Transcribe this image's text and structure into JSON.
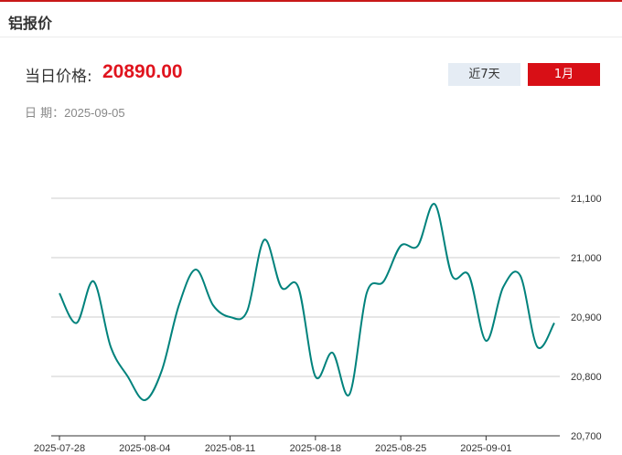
{
  "header": {
    "title": "铝报价"
  },
  "price": {
    "label": "当日价格:",
    "value": "20890.00"
  },
  "date": {
    "label": "日 期：",
    "value": "2025-09-05"
  },
  "buttons": {
    "week": "近7天",
    "month": "1月"
  },
  "colors": {
    "accent": "#d80f16",
    "price": "#e0141e",
    "line": "#00827c",
    "button_inactive": "#e5ecf4"
  },
  "chart_data": {
    "type": "line",
    "x": [
      "2025-07-28",
      "2025-07-29",
      "2025-07-30",
      "2025-07-31",
      "2025-08-01",
      "2025-08-04",
      "2025-08-05",
      "2025-08-06",
      "2025-08-07",
      "2025-08-08",
      "2025-08-11",
      "2025-08-12",
      "2025-08-13",
      "2025-08-14",
      "2025-08-15",
      "2025-08-18",
      "2025-08-19",
      "2025-08-20",
      "2025-08-21",
      "2025-08-22",
      "2025-08-25",
      "2025-08-26",
      "2025-08-27",
      "2025-08-28",
      "2025-08-29",
      "2025-09-01",
      "2025-09-02",
      "2025-09-03",
      "2025-09-04",
      "2025-09-05"
    ],
    "series": [
      {
        "values": [
          20940,
          20890,
          20960,
          20850,
          20800,
          20760,
          20810,
          20920,
          20980,
          20920,
          20900,
          20910,
          21030,
          20950,
          20950,
          20800,
          20840,
          20770,
          20940,
          20960,
          21020,
          21020,
          21090,
          20970,
          20970,
          20860,
          20950,
          20970,
          20850,
          20890
        ]
      }
    ],
    "xticks": [
      "2025-07-28",
      "2025-08-04",
      "2025-08-11",
      "2025-08-18",
      "2025-08-25",
      "2025-09-01"
    ],
    "yticks": [
      20700,
      20800,
      20900,
      21000,
      21100
    ],
    "ytick_labels": [
      "20,700",
      "20,800",
      "20,900",
      "21,000",
      "21,100"
    ],
    "ylim": [
      20700,
      21100
    ],
    "grid": true,
    "legend": "none"
  }
}
